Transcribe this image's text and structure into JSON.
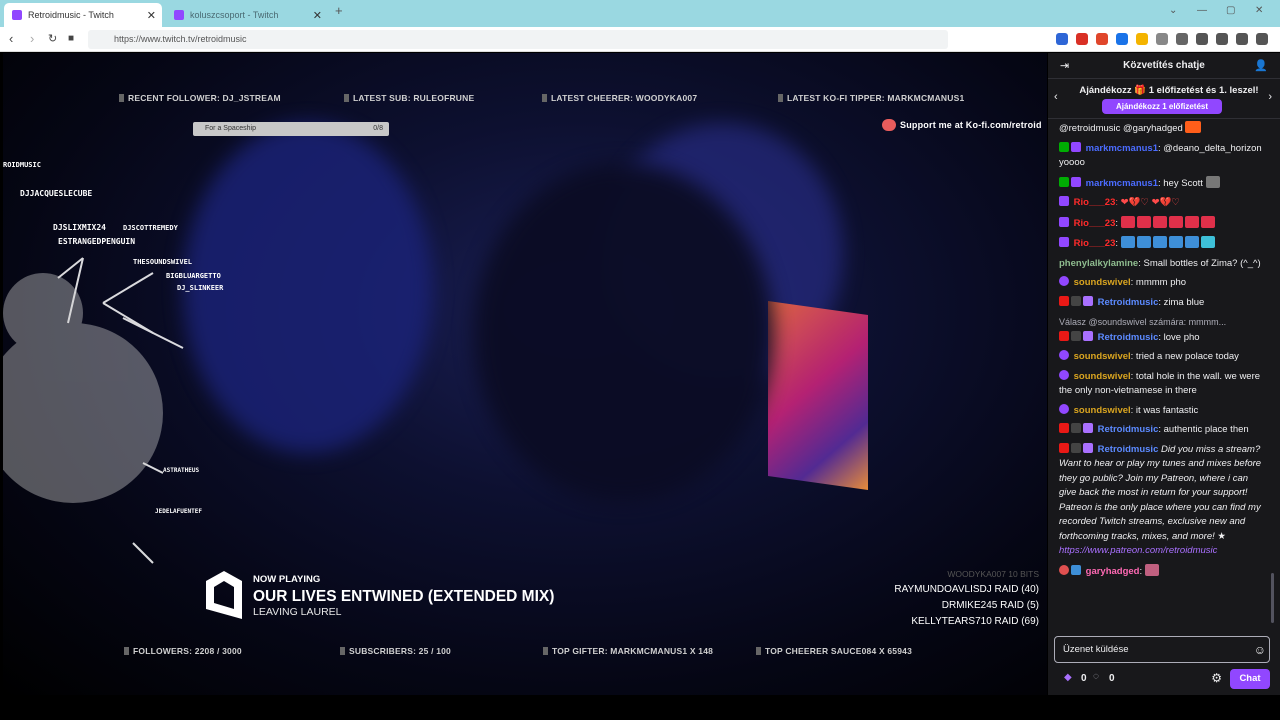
{
  "browser": {
    "tabs": [
      {
        "title": "Retroidmusic - Twitch"
      },
      {
        "title": "koluszcsoport - Twitch"
      }
    ],
    "new_tab": "+",
    "url": "https://www.twitch.tv/retroidmusic"
  },
  "overlay": {
    "top": [
      {
        "label": "RECENT FOLLOWER: DJ_JSTREAM"
      },
      {
        "label": "LATEST SUB: RULEOFRUNE"
      },
      {
        "label": "LATEST CHEERER: WOODYKA007"
      },
      {
        "label": "LATEST KO-FI TIPPER: MARKMCMANUS1"
      }
    ],
    "kofi": "Support me at Ko-fi.com/retroid",
    "spaceship_bar": "For a Spaceship",
    "spaceship_count": "0/8",
    "burst_title": "ROIDMUSIC",
    "burst_names": [
      "DJJACQUESLECUBE",
      "DJSLIXMIX24",
      "DJSCOTTREMEDY",
      "ESTRANGEDPENGUIN",
      "THESOUNDSWIVEL",
      "BIGBLUARGETTO",
      "DJ_SLINKEER",
      "ASTRATHEUS",
      "JEDELAFUENTEF"
    ],
    "now_playing_label": "NOW PLAYING",
    "track_title": "OUR LIVES ENTWINED (EXTENDED MIX)",
    "artist": "LEAVING LAUREL",
    "events": [
      {
        "text": "WOODYKA007   10 BITS"
      },
      {
        "text": "RAYMUNDOAVLISDJ   RAID (40)"
      },
      {
        "text": "DRMIKE245   RAID (5)"
      },
      {
        "text": "KELLYTEARS710   RAID (69)"
      }
    ],
    "bottom": [
      {
        "label": "FOLLOWERS: 2208 / 3000"
      },
      {
        "label": "SUBSCRIBERS: 25 / 100"
      },
      {
        "label": "TOP GIFTER: MARKMCMANUS1 X 148"
      },
      {
        "label": "TOP CHEERER  SAUCE084 X 65943"
      }
    ]
  },
  "chat": {
    "title": "Közvetítés chatje",
    "gift_text": "Ajándékozz 🎁 1 előfizetést és 1. leszel!",
    "gift_button": "Ajándékozz 1 előfizetést",
    "messages": [
      {
        "user": "",
        "color": "#efeff1",
        "text": "@retroidmusic @garyhadged"
      },
      {
        "user": "markmcmanus1",
        "color": "#4b6cff",
        "text": ": @deano_delta_horizon yoooo"
      },
      {
        "user": "markmcmanus1",
        "color": "#4b6cff",
        "text": ": hey Scott"
      },
      {
        "user": "Rio___23",
        "color": "#ff2b2b",
        "text": ": ❤💔♡ ❤💔♡"
      },
      {
        "user": "Rio___23",
        "color": "#ff2b2b",
        "text": ":"
      },
      {
        "user": "Rio___23",
        "color": "#ff2b2b",
        "text": ":"
      },
      {
        "user": "phenylalkylamine",
        "color": "#8fbc8f",
        "text": ": Small bottles of Zima? (^_^)"
      },
      {
        "user": "soundswivel",
        "color": "#daa520",
        "text": ": mmmm pho"
      },
      {
        "user": "Retroidmusic",
        "color": "#5c8aff",
        "text": ": zima blue"
      },
      {
        "user": "Retroidmusic",
        "color": "#5c8aff",
        "text": ": love pho",
        "reply": "Válasz @soundswivel számára: mmmm..."
      },
      {
        "user": "soundswivel",
        "color": "#daa520",
        "text": ": tried a new polace today"
      },
      {
        "user": "soundswivel",
        "color": "#daa520",
        "text": ": total hole in the wall. we were the only non-vietnamese in there"
      },
      {
        "user": "soundswivel",
        "color": "#daa520",
        "text": ": it was fantastic"
      },
      {
        "user": "Retroidmusic",
        "color": "#5c8aff",
        "text": ": authentic place then"
      },
      {
        "user": "Retroidmusic",
        "color": "#5c8aff",
        "text": " Did you miss a stream? Want to hear or play my tunes and mixes before they go public? Join my Patreon, where i can give back the most in return for your support! Patreon is the only place where you can find my recorded Twitch streams, exclusive new and forthcoming tracks, mixes, and more! ★ ",
        "link": "https://www.patreon.com/retroidmusic",
        "italic": true
      },
      {
        "user": "garyhadged",
        "color": "#ff69b4",
        "text": ":"
      }
    ],
    "input_placeholder": "Üzenet küldése",
    "bits": "0",
    "points": "0",
    "send": "Chat"
  }
}
